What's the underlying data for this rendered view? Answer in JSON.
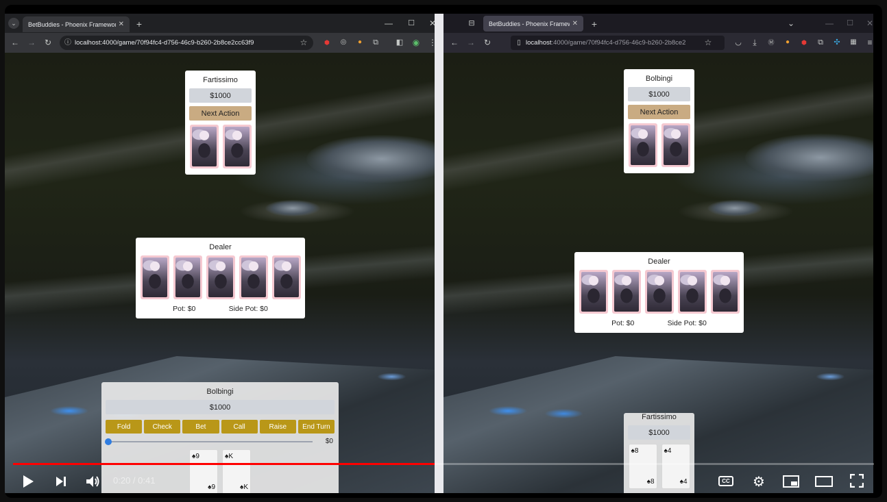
{
  "left_browser": {
    "tab_title": "BetBuddies - Phoenix Framework",
    "url": "localhost:4000/game/70f94fc4-d756-46c9-b260-2b8ce2cc63f9",
    "opponent": {
      "name": "Fartissimo",
      "bankroll": "$1000",
      "next_action_label": "Next Action"
    },
    "dealer": {
      "title": "Dealer",
      "pot": "Pot: $0",
      "side_pot": "Side Pot: $0"
    },
    "player": {
      "name": "Bolbingi",
      "bankroll": "$1000",
      "actions": [
        "Fold",
        "Check",
        "Bet",
        "Call",
        "Raise",
        "End Turn"
      ],
      "bet_amount": "$0",
      "bet_fraction": 0,
      "cards": [
        {
          "top": "♠9",
          "bottom": "♠9"
        },
        {
          "top": "♠K",
          "bottom": "♠K"
        }
      ]
    }
  },
  "right_browser": {
    "tab_title": "BetBuddies - Phoenix Framework",
    "url_host": "localhost",
    "url_path": ":4000/game/70f94fc4-d756-46c9-b260-2b8ce2",
    "opponent": {
      "name": "Bolbingi",
      "bankroll": "$1000",
      "next_action_label": "Next Action"
    },
    "dealer": {
      "title": "Dealer",
      "pot": "Pot: $0",
      "side_pot": "Side Pot: $0"
    },
    "player": {
      "name": "Fartissimo",
      "bankroll": "$1000",
      "cards": [
        {
          "top": "♠8",
          "bottom": "♠8"
        },
        {
          "top": "♠4",
          "bottom": "♠4"
        }
      ]
    }
  },
  "video": {
    "time": "0:20 / 0:41",
    "progress_fraction": 0.49,
    "cc_label": "CC",
    "accent_color": "#ff0000"
  }
}
